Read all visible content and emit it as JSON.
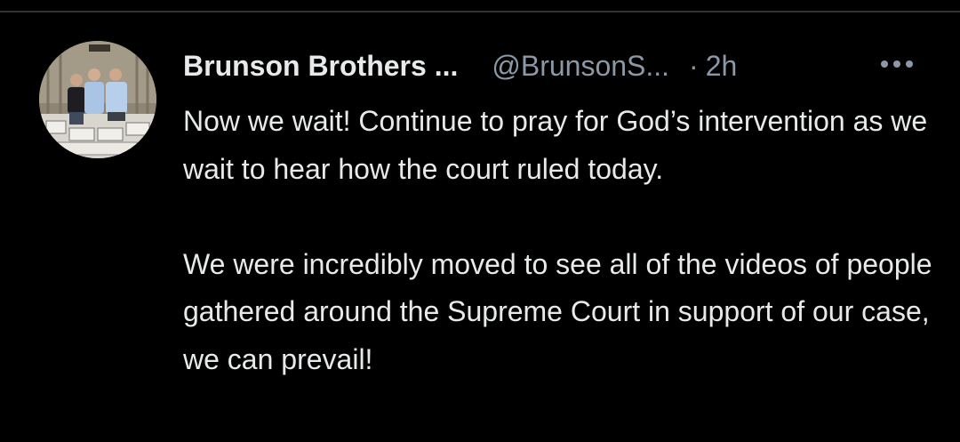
{
  "tweet": {
    "display_name": "Brunson Brothers ...",
    "handle": "@BrunsonS...",
    "separator": "·",
    "time": "2h",
    "more_icon": "ellipsis-horizontal-icon",
    "paragraphs": [
      "Now we wait! Continue to pray for God’s intervention as we wait to hear how the court ruled today.",
      "We were incredibly moved to see all of the videos of people gathered around the Supreme Court in support of our case, we can prevail!"
    ]
  },
  "colors": {
    "background": "#000000",
    "primary_text": "#e7e9ea",
    "secondary_text": "#8b98a5",
    "divider": "#2f3336"
  }
}
